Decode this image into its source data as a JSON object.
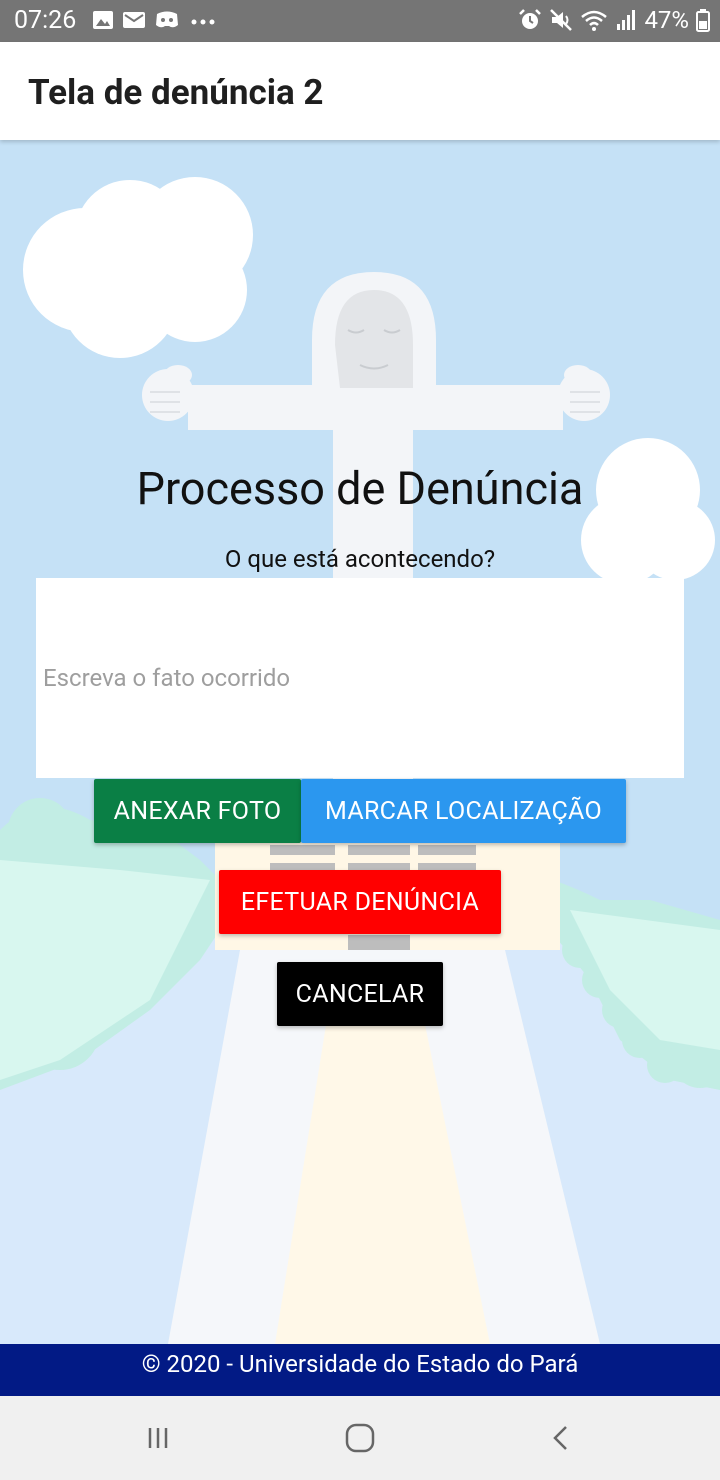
{
  "status_bar": {
    "time": "07:26",
    "battery": "47%",
    "left_icons": [
      "image-icon",
      "mail-icon",
      "discord-icon",
      "more-icon"
    ],
    "right_icons": [
      "alarm-icon",
      "mute-icon",
      "wifi-icon",
      "signal-icon",
      "battery-icon"
    ]
  },
  "app_bar": {
    "title": "Tela de denúncia 2"
  },
  "form": {
    "title": "Processo de Denúncia",
    "question": "O que está acontecendo?",
    "textarea_placeholder": "Escreva o fato ocorrido",
    "buttons": {
      "attach_photo": "ANEXAR FOTO",
      "mark_location": "MARCAR LOCALIZAÇÃO",
      "submit_report": "EFETUAR DENÚNCIA",
      "cancel": "CANCELAR"
    }
  },
  "footer": {
    "text": "© 2020 - Universidade do Estado do Pará"
  },
  "nav_bar": {
    "icons": [
      "recent-apps-icon",
      "home-icon",
      "back-icon"
    ]
  },
  "colors": {
    "sky": "#c5e1f6",
    "attach_photo": "#0a7f45",
    "mark_location": "#2b97ef",
    "submit_report": "#ff0000",
    "cancel": "#000000",
    "footer": "#021a85"
  }
}
